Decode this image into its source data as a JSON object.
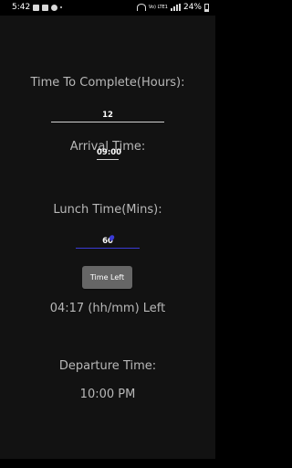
{
  "status_bar": {
    "time": "5:42",
    "network": "Vo) LTE1",
    "battery": "24%"
  },
  "form": {
    "hours_label": "Time To Complete(Hours):",
    "hours_value": "12",
    "arrival_label": "Arrival Time:",
    "arrival_value": "09:00",
    "lunch_label": "Lunch Time(Mins):",
    "lunch_value": "60",
    "button_label": "Time Left"
  },
  "results": {
    "time_left": "04:17 (hh/mm) Left",
    "departure_label": "Departure Time:",
    "departure_value": "10:00 PM"
  },
  "colors": {
    "background": "#121212",
    "label_text": "#b8b8b8",
    "button_bg": "#666666",
    "focus_accent": "#3b3bd6"
  }
}
